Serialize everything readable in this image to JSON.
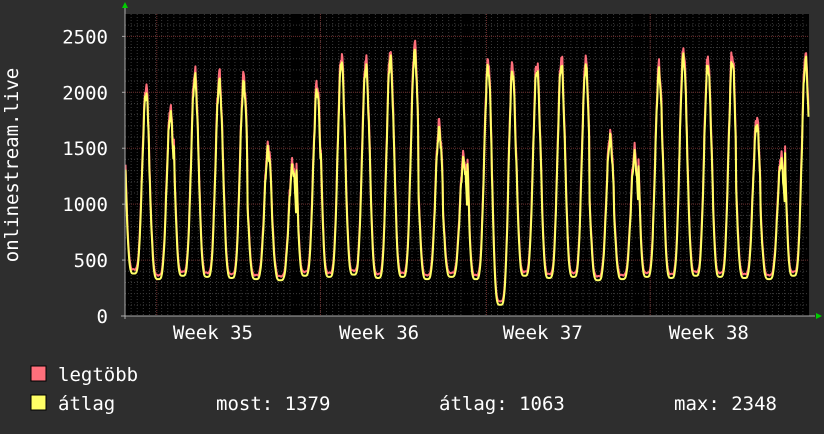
{
  "chart_data": {
    "type": "line",
    "ylabel": "onlinestream.live",
    "ylim": [
      0,
      2700
    ],
    "yticks": [
      0,
      500,
      1000,
      1500,
      2000,
      2500
    ],
    "x_start_day": 0,
    "x_end_day": 28,
    "week_labels": [
      "Week 35",
      "Week 36",
      "Week 37",
      "Week 38"
    ],
    "week_centers_day": [
      3.6,
      10.4,
      17.1,
      23.9
    ],
    "grid": true,
    "daily_peaks_avg": [
      1990,
      1800,
      2130,
      2090,
      2080,
      1480,
      1320,
      2020,
      2270,
      2230,
      2300,
      2360,
      1660,
      1380,
      2220,
      2190,
      2200,
      2240,
      2230,
      1580,
      1420,
      2170,
      2320,
      2240,
      2280,
      1710,
      1380,
      2280,
      2260
    ],
    "series": [
      {
        "name": "legtöbb",
        "color": "#ff6f7b"
      },
      {
        "name": "átlag",
        "color": "#ffff66"
      }
    ],
    "stats": {
      "most": "most: 1379",
      "atlag": "átlag: 1063",
      "max": "max: 2348"
    }
  },
  "colors": {
    "background": "#2e2e2e",
    "plot_background": "#000000",
    "grid_minor": "#3a3a3a",
    "grid_major": "#6b2d2d",
    "axis": "#aaaaaa",
    "arrow": "#00cc00",
    "text": "#ffffff",
    "series_max": "#ff6f7b",
    "series_avg": "#ffff66"
  }
}
